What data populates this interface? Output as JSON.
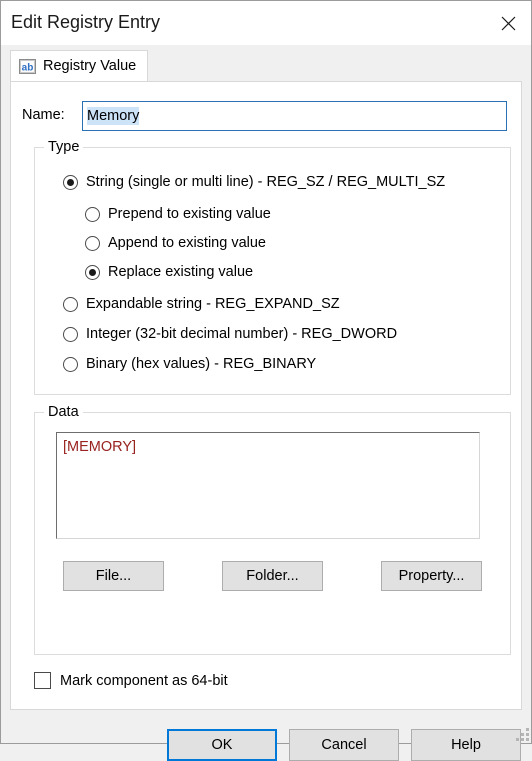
{
  "window": {
    "title": "Edit Registry Entry",
    "close_icon": "close-icon"
  },
  "tabs": [
    {
      "label": "Registry Value",
      "icon": "ab-string-icon",
      "selected": true
    }
  ],
  "name_field": {
    "label": "Name:",
    "value": "Memory",
    "selected": true,
    "selection_color": "#cce3f8"
  },
  "type_group": {
    "title": "Type",
    "options": [
      {
        "label": "String (single or multi line) - REG_SZ / REG_MULTI_SZ",
        "checked": true,
        "indent": false
      },
      {
        "label": "Prepend to existing value",
        "checked": false,
        "indent": true
      },
      {
        "label": "Append to existing value",
        "checked": false,
        "indent": true
      },
      {
        "label": "Replace existing value",
        "checked": true,
        "indent": true
      },
      {
        "label": "Expandable string - REG_EXPAND_SZ",
        "checked": false,
        "indent": false
      },
      {
        "label": "Integer (32-bit decimal number) - REG_DWORD",
        "checked": false,
        "indent": false
      },
      {
        "label": "Binary (hex values) - REG_BINARY",
        "checked": false,
        "indent": false
      }
    ]
  },
  "data_group": {
    "title": "Data",
    "value": "[MEMORY]",
    "text_color": "#98231f",
    "buttons": {
      "file": "File...",
      "folder": "Folder...",
      "property": "Property..."
    }
  },
  "mark_64bit": {
    "label": "Mark component as 64-bit",
    "checked": false
  },
  "footer": {
    "ok": "OK",
    "cancel": "Cancel",
    "help": "Help",
    "default_button": "OK",
    "focus_color": "#0078d7"
  }
}
